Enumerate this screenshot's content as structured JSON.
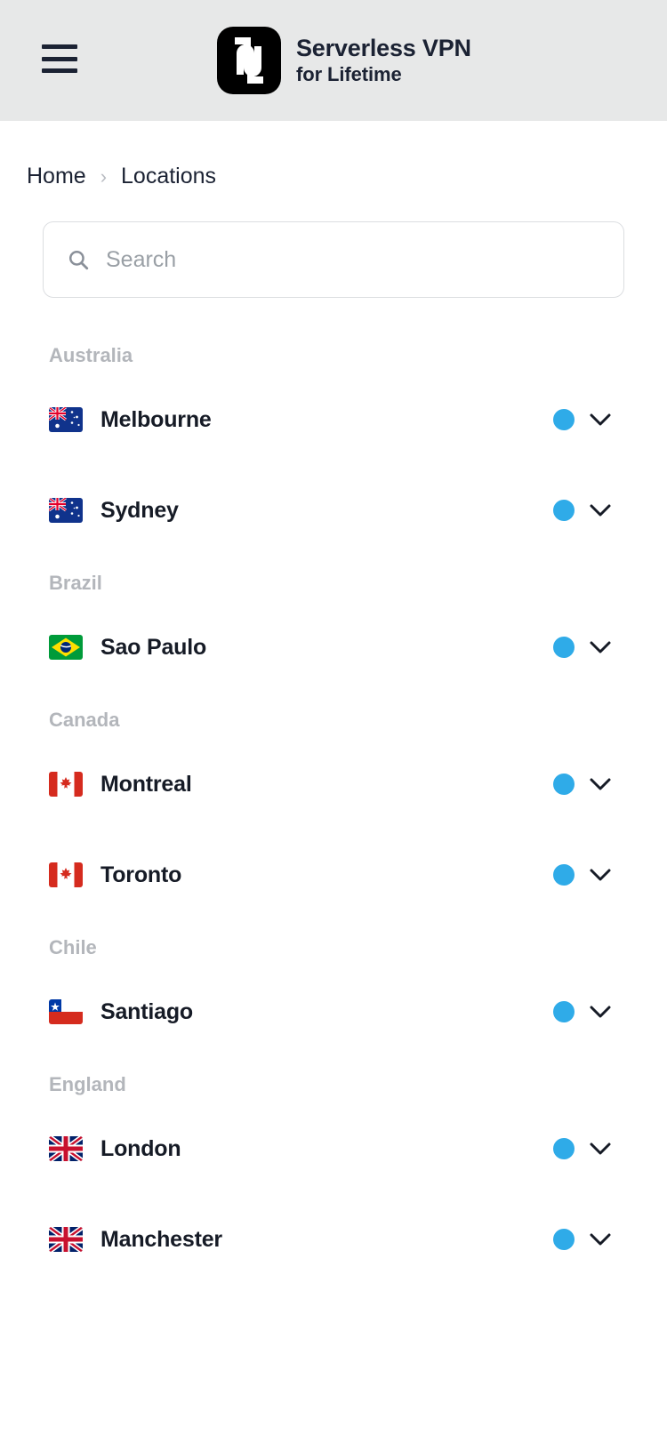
{
  "header": {
    "menu_icon": "hamburger-menu-icon",
    "logo_icon": "app-logo-icon",
    "title_line1": "Serverless VPN",
    "title_line2": "for Lifetime",
    "background_color": "#e7e8e8",
    "title_color": "#1b2233"
  },
  "breadcrumb": {
    "items": [
      {
        "label": "Home"
      },
      {
        "label": "Locations"
      }
    ],
    "separator": "›"
  },
  "search": {
    "icon": "search-icon",
    "placeholder": "Search",
    "value": ""
  },
  "list": {
    "status_dot_color": "#2fabe8",
    "expand_icon": "chevron-down-icon",
    "groups": [
      {
        "country": "Australia",
        "flag": "flag-au",
        "cities": [
          {
            "name": "Melbourne",
            "status": "online"
          },
          {
            "name": "Sydney",
            "status": "online"
          }
        ]
      },
      {
        "country": "Brazil",
        "flag": "flag-br",
        "cities": [
          {
            "name": "Sao Paulo",
            "status": "online"
          }
        ]
      },
      {
        "country": "Canada",
        "flag": "flag-ca",
        "cities": [
          {
            "name": "Montreal",
            "status": "online"
          },
          {
            "name": "Toronto",
            "status": "online"
          }
        ]
      },
      {
        "country": "Chile",
        "flag": "flag-cl",
        "cities": [
          {
            "name": "Santiago",
            "status": "online"
          }
        ]
      },
      {
        "country": "England",
        "flag": "flag-gb",
        "cities": [
          {
            "name": "London",
            "status": "online"
          },
          {
            "name": "Manchester",
            "status": "online"
          }
        ]
      }
    ]
  }
}
